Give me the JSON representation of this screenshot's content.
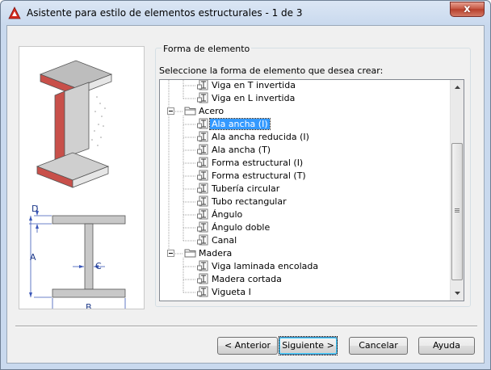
{
  "window": {
    "title": "Asistente para estilo de elementos estructurales - 1 de 3",
    "close_label": "x"
  },
  "group": {
    "legend": "Forma de elemento",
    "prompt": "Seleccione la forma de elemento que desea crear:"
  },
  "tree": {
    "nodes": [
      {
        "label": "Viga en T invertida",
        "type": "shape"
      },
      {
        "label": "Viga en L invertida",
        "type": "shape"
      },
      {
        "label": "Acero",
        "type": "folder",
        "expanded": true
      },
      {
        "label": "Ala ancha (I)",
        "type": "shape",
        "selected": true
      },
      {
        "label": "Ala ancha reducida (I)",
        "type": "shape"
      },
      {
        "label": "Ala ancha (T)",
        "type": "shape"
      },
      {
        "label": "Forma estructural (I)",
        "type": "shape"
      },
      {
        "label": "Forma estructural (T)",
        "type": "shape"
      },
      {
        "label": "Tubería circular",
        "type": "shape"
      },
      {
        "label": "Tubo rectangular",
        "type": "shape"
      },
      {
        "label": "Ángulo",
        "type": "shape"
      },
      {
        "label": "Ángulo doble",
        "type": "shape"
      },
      {
        "label": "Canal",
        "type": "shape"
      },
      {
        "label": "Madera",
        "type": "folder",
        "expanded": true
      },
      {
        "label": "Viga laminada encolada",
        "type": "shape"
      },
      {
        "label": "Madera cortada",
        "type": "shape"
      },
      {
        "label": "Vigueta I",
        "type": "shape"
      }
    ]
  },
  "preview": {
    "dim_labels": {
      "d": "D",
      "a": "A",
      "c": "C",
      "b": "B"
    }
  },
  "buttons": {
    "back": "< Anterior",
    "next": "Siguiente >",
    "cancel": "Cancelar",
    "help": "Ayuda"
  },
  "colors": {
    "selection": "#3399ff",
    "flange_red": "#c8504a"
  }
}
